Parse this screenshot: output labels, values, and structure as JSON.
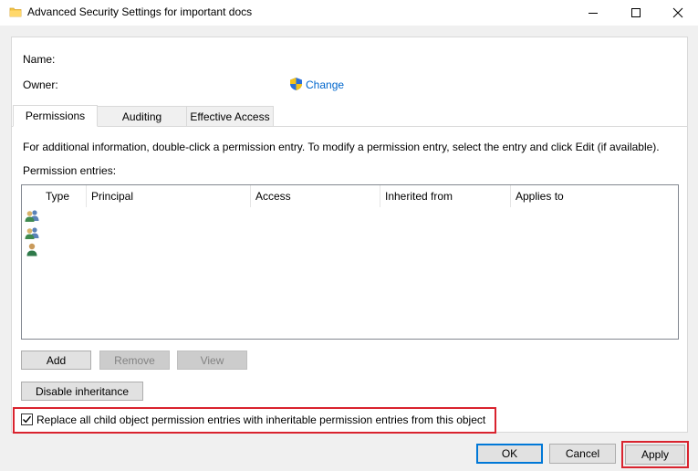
{
  "window": {
    "title": "Advanced Security Settings for important docs"
  },
  "info": {
    "name_label": "Name:",
    "owner_label": "Owner:",
    "change_link": "Change"
  },
  "tabs": [
    {
      "label": "Permissions",
      "active": true
    },
    {
      "label": "Auditing",
      "active": false
    },
    {
      "label": "Effective Access",
      "active": false
    }
  ],
  "permissions": {
    "info_text": "For additional information, double-click a permission entry. To modify a permission entry, select the entry and click Edit (if available).",
    "entries_label": "Permission entries:",
    "columns": [
      "Type",
      "Principal",
      "Access",
      "Inherited from",
      "Applies to"
    ],
    "entry_icons": [
      "user-group-icon",
      "user-group-icon",
      "user-icon"
    ]
  },
  "buttons": {
    "add": "Add",
    "remove": "Remove",
    "view": "View",
    "disable_inheritance": "Disable inheritance"
  },
  "replace_checkbox": {
    "label": "Replace all child object permission entries with inheritable permission entries from this object",
    "checked": true
  },
  "footer": {
    "ok": "OK",
    "cancel": "Cancel",
    "apply": "Apply"
  },
  "colors": {
    "highlight": "#d9232e",
    "link": "#0066cc",
    "focus": "#0078d7"
  }
}
